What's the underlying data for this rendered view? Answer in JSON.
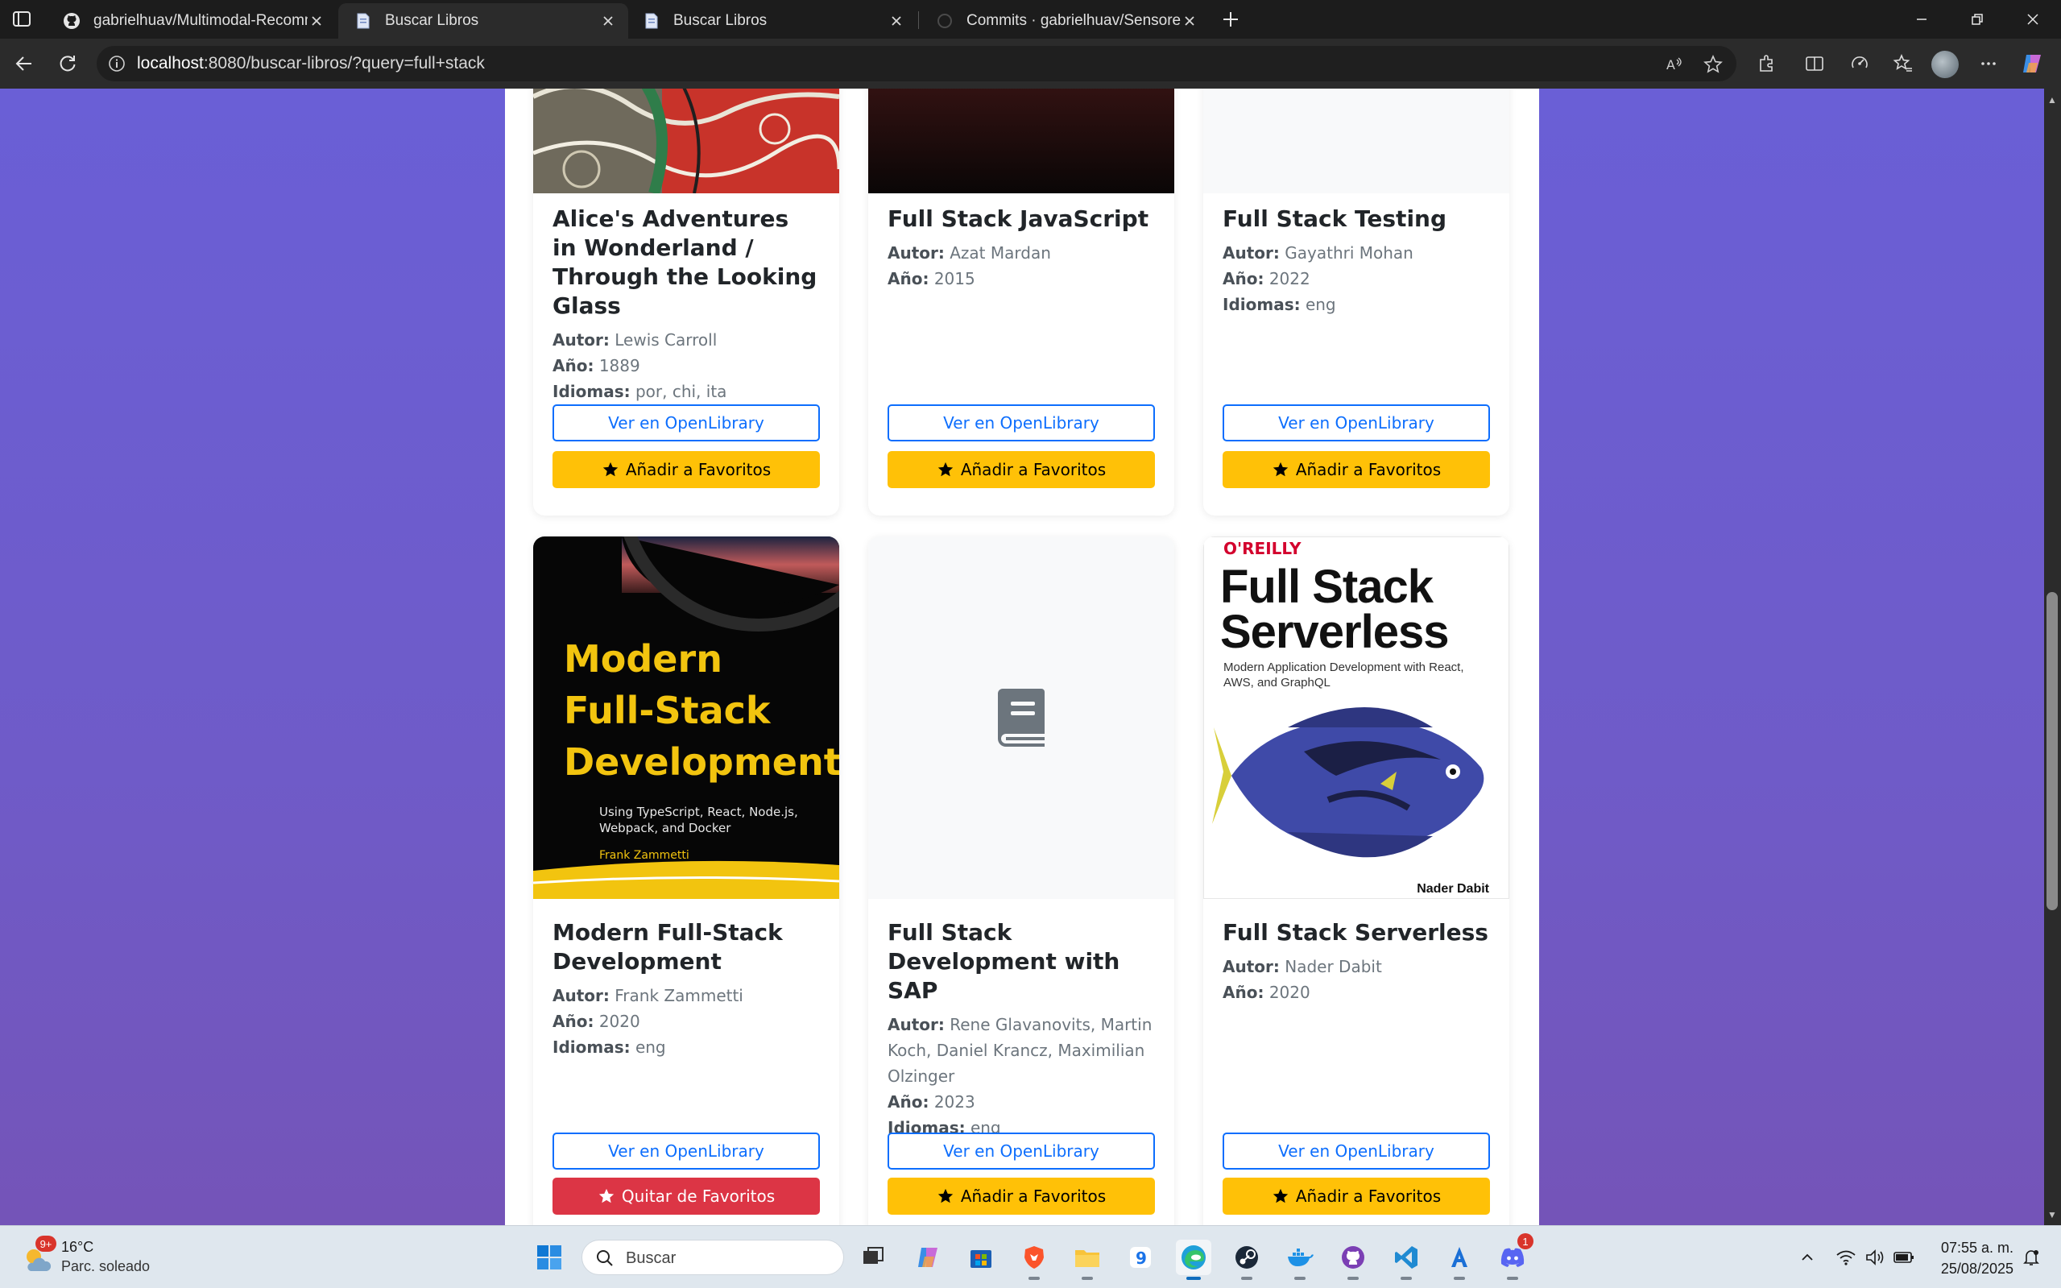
{
  "browser": {
    "tabs": [
      {
        "title": "gabrielhuav/Multimodal-Recomm"
      },
      {
        "title": "Buscar Libros"
      },
      {
        "title": "Buscar Libros"
      },
      {
        "title": "Commits · gabrielhuav/Sensores_I"
      }
    ],
    "url_host": "localhost",
    "url_path": ":8080/buscar-libros/?query=full+stack"
  },
  "books": [
    {
      "title": "Alice's Adventures in Wonderland / Through the Looking Glass",
      "author": "Lewis Carroll",
      "year": "1889",
      "languages": "por, chi, ita",
      "fav_label": "Añadir a Favoritos"
    },
    {
      "title": "Full Stack JavaScript",
      "author": "Azat Mardan",
      "year": "2015",
      "fav_label": "Añadir a Favoritos"
    },
    {
      "title": "Full Stack Testing",
      "author": "Gayathri Mohan",
      "year": "2022",
      "languages": "eng",
      "fav_label": "Añadir a Favoritos"
    },
    {
      "title": "Modern Full-Stack Development",
      "author": "Frank Zammetti",
      "year": "2020",
      "languages": "eng",
      "fav_label": "Quitar de Favoritos",
      "cover_title": [
        "Modern",
        "Full-Stack",
        "Development"
      ],
      "cover_subtitle": [
        "Using TypeScript, React, Node.js,",
        "Webpack, and Docker"
      ],
      "cover_author": "Frank Zammetti"
    },
    {
      "title": "Full Stack Development with SAP",
      "author": "Rene Glavanovits, Martin Koch, Daniel Krancz, Maximilian Olzinger",
      "year": "2023",
      "languages": "eng",
      "fav_label": "Añadir a Favoritos"
    },
    {
      "title": "Full Stack Serverless",
      "author": "Nader Dabit",
      "year": "2020",
      "fav_label": "Añadir a Favoritos",
      "cover_publisher": "O'REILLY",
      "cover_title": [
        "Full Stack",
        "Serverless"
      ],
      "cover_subtitle": [
        "Modern Application Development with React,",
        "AWS, and GraphQL"
      ],
      "cover_author": "Nader Dabit"
    }
  ],
  "labels": {
    "author": "Autor:",
    "year": "Año:",
    "languages": "Idiomas:",
    "open_library": "Ver en OpenLibrary"
  },
  "colors": {
    "primary": "#0d6efd",
    "warning": "#ffc107",
    "danger": "#dc3545",
    "page_gradient_top": "#6a5fd6",
    "page_gradient_bottom": "#7454b8"
  },
  "taskbar": {
    "weather_badge": "9+",
    "temperature": "16°C",
    "condition": "Parc. soleado",
    "search_placeholder": "Buscar",
    "discord_badge": "1",
    "time": "07:55 a. m.",
    "date": "25/08/2025"
  }
}
